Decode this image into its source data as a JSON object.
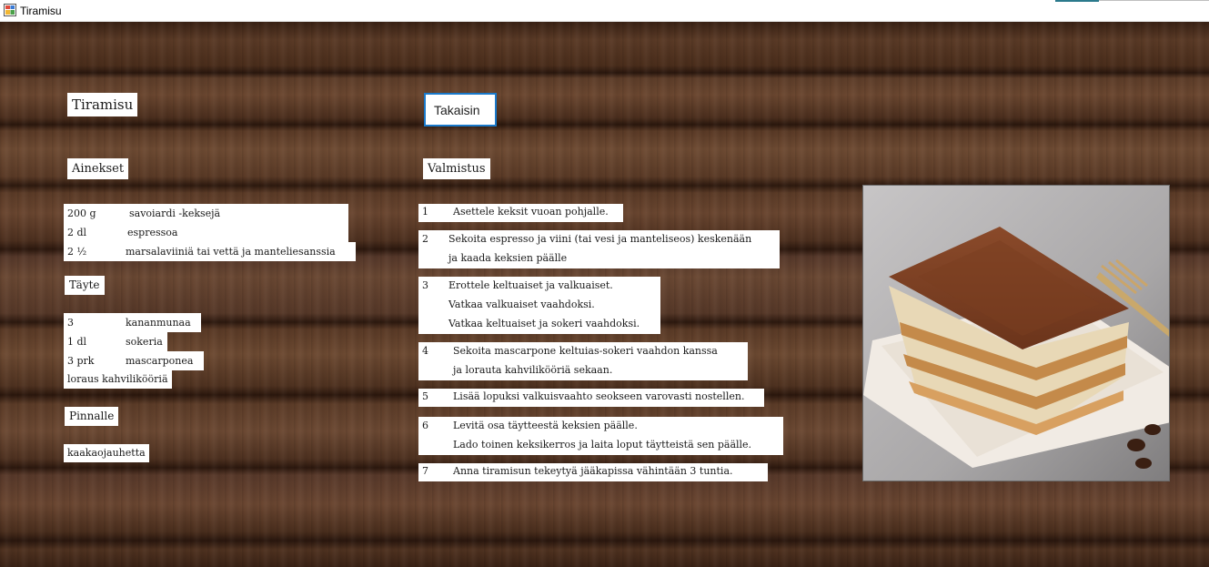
{
  "window": {
    "title": "Tiramisu"
  },
  "header": {
    "title": "Tiramisu",
    "back_button": "Takaisin"
  },
  "ingredients": {
    "heading": "Ainekset",
    "base": [
      {
        "qty": "200 g",
        "name": "savoiardi -keksejä"
      },
      {
        "qty": "2 dl",
        "name": "espressoa"
      },
      {
        "qty": "2 ½",
        "name": "marsalaviiniä tai vettä ja manteliesanssia"
      }
    ],
    "filling_heading": "Täyte",
    "filling": [
      {
        "qty": "3",
        "name": "kananmunaa"
      },
      {
        "qty": "1 dl",
        "name": "sokeria"
      },
      {
        "qty": "3 prk",
        "name": "mascarponea"
      }
    ],
    "filling_extra": "loraus kahvilikööriä",
    "topping_heading": "Pinnalle",
    "topping": "kaakaojauhetta"
  },
  "method": {
    "heading": "Valmistus",
    "steps": [
      {
        "num": "1",
        "lines": [
          "Asettele keksit vuoan pohjalle."
        ]
      },
      {
        "num": "2",
        "lines": [
          "Sekoita espresso ja viini (tai vesi ja manteliseos) keskenään",
          "ja kaada keksien päälle"
        ]
      },
      {
        "num": "3",
        "lines": [
          "Erottele keltuaiset ja valkuaiset.",
          "Vatkaa valkuaiset vaahdoksi.",
          "Vatkaa keltuaiset ja sokeri vaahdoksi."
        ]
      },
      {
        "num": "4",
        "lines": [
          "Sekoita mascarpone keltuias-sokeri vaahdon kanssa",
          "ja lorauta kahvilikööriä sekaan."
        ]
      },
      {
        "num": "5",
        "lines": [
          "Lisää lopuksi valkuisvaahto seokseen varovasti nostellen."
        ]
      },
      {
        "num": "6",
        "lines": [
          "Levitä osa täytteestä keksien päälle.",
          "Lado toinen keksikerros ja laita loput täytteistä sen päälle."
        ]
      },
      {
        "num": "7",
        "lines": [
          "Anna tiramisun tekeytyä jääkapissa vähintään 3 tuntia."
        ]
      }
    ]
  },
  "icons": {
    "app": "form-icon"
  },
  "colors": {
    "button_border": "#1979ca",
    "wood": "#5a3a26"
  }
}
